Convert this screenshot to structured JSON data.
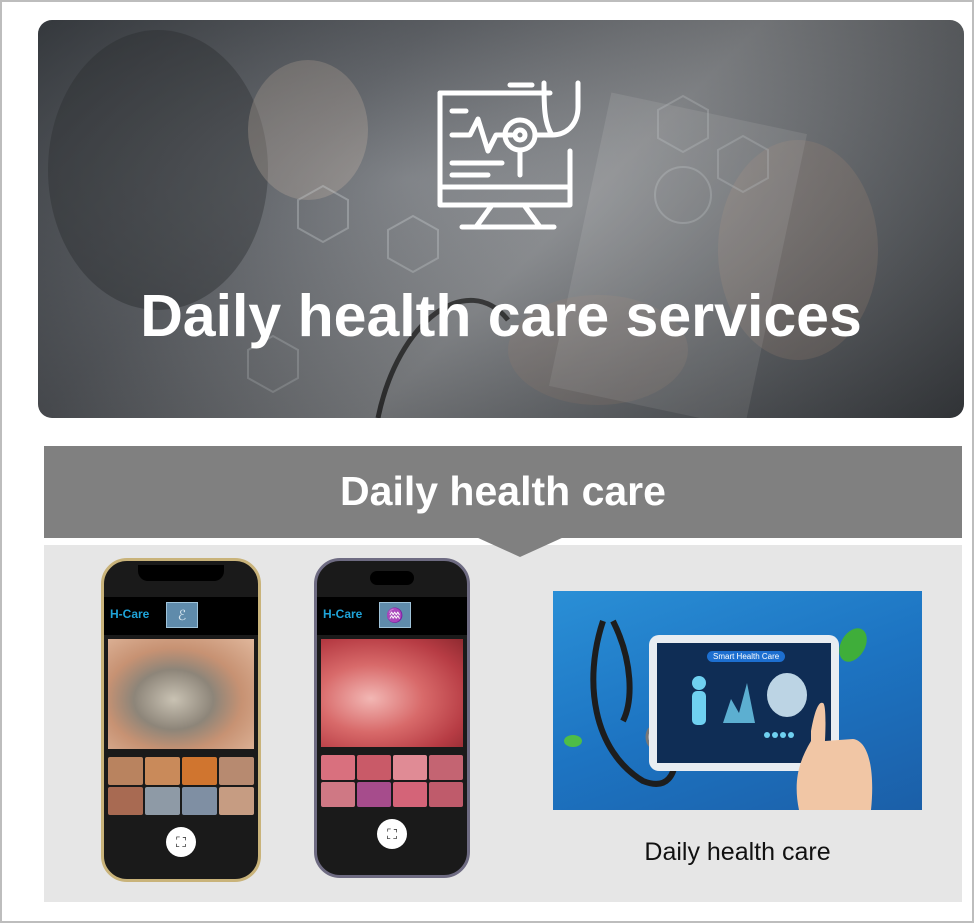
{
  "hero": {
    "title": "Daily health care services",
    "icon": "monitor-stethoscope-icon"
  },
  "banner": {
    "title": "Daily health care"
  },
  "phones": [
    {
      "app_label": "H-Care",
      "mode_icon": "ear-icon",
      "shutter_icon": "capture-icon"
    },
    {
      "app_label": "H-Care",
      "mode_icon": "throat-icon",
      "shutter_icon": "capture-icon"
    }
  ],
  "photo": {
    "screen_header": "Smart Health Care",
    "caption": "Daily health care"
  },
  "colors": {
    "banner_gray": "#808080",
    "panel_gray": "#e6e6e6",
    "app_label_blue": "#1fa3d8"
  }
}
